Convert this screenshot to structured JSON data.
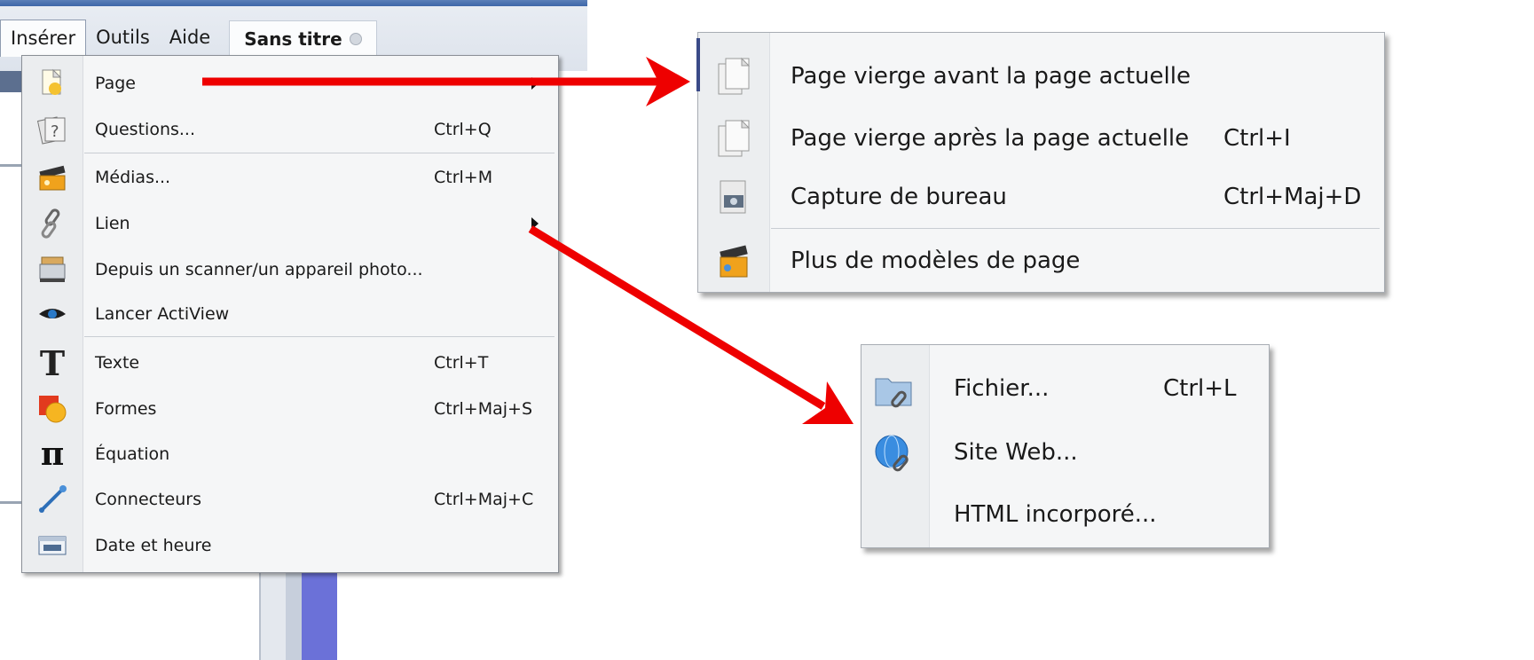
{
  "menubar": {
    "items": [
      {
        "label": "Insérer"
      },
      {
        "label": "Outils"
      },
      {
        "label": "Aide"
      }
    ],
    "document_tab": "Sans titre"
  },
  "main_menu": {
    "items": [
      {
        "label": "Page",
        "shortcut": "",
        "icon": "page-icon"
      },
      {
        "label": "Questions...",
        "shortcut": "Ctrl+Q",
        "icon": "questions-icon"
      },
      {
        "label": "Médias...",
        "shortcut": "Ctrl+M",
        "icon": "media-icon"
      },
      {
        "label": "Lien",
        "shortcut": "",
        "icon": "link-icon"
      },
      {
        "label": "Depuis un scanner/un appareil photo...",
        "shortcut": "",
        "icon": "scanner-icon"
      },
      {
        "label": "Lancer ActiView",
        "shortcut": "",
        "icon": "eye-icon"
      },
      {
        "label": "Texte",
        "shortcut": "Ctrl+T",
        "icon": "text-icon"
      },
      {
        "label": "Formes",
        "shortcut": "Ctrl+Maj+S",
        "icon": "shapes-icon"
      },
      {
        "label": "Équation",
        "shortcut": "",
        "icon": "pi-icon"
      },
      {
        "label": "Connecteurs",
        "shortcut": "Ctrl+Maj+C",
        "icon": "connector-icon"
      },
      {
        "label": "Date et heure",
        "shortcut": "",
        "icon": "calendar-icon"
      }
    ]
  },
  "page_submenu": {
    "items": [
      {
        "label": "Page vierge avant la page actuelle",
        "shortcut": "",
        "icon": "blank-page-icon"
      },
      {
        "label": "Page vierge après la page actuelle",
        "shortcut": "Ctrl+I",
        "icon": "blank-page-icon"
      },
      {
        "label": "Capture de bureau",
        "shortcut": "Ctrl+Maj+D",
        "icon": "camera-icon"
      },
      {
        "label": "Plus de modèles de page",
        "shortcut": "",
        "icon": "templates-icon"
      }
    ]
  },
  "link_submenu": {
    "items": [
      {
        "label": "Fichier...",
        "shortcut": "Ctrl+L",
        "icon": "folder-link-icon"
      },
      {
        "label": "Site Web...",
        "shortcut": "",
        "icon": "globe-link-icon"
      },
      {
        "label": "HTML incorporé...",
        "shortcut": "",
        "icon": ""
      }
    ]
  },
  "colors": {
    "arrow": "#ee0000",
    "menu_bg": "#f5f6f7",
    "gutter": "#ebedef"
  }
}
